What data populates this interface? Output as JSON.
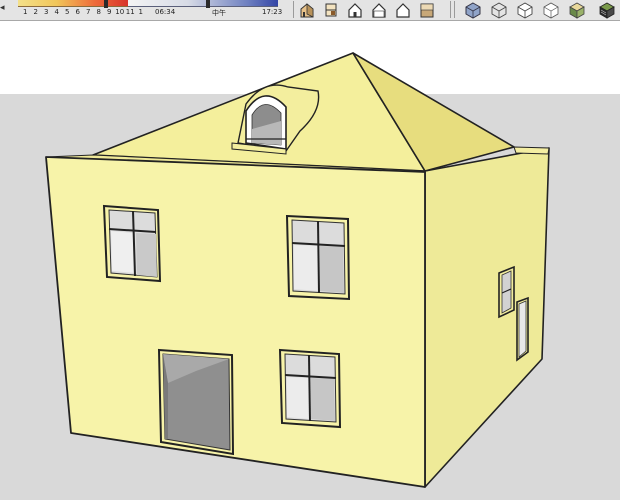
{
  "shadow_settings": {
    "month_labels": [
      "1",
      "2",
      "3",
      "4",
      "5",
      "6",
      "7",
      "8",
      "9",
      "10",
      "11",
      "1"
    ],
    "time_start": "06:34",
    "time_mid": "中午",
    "time_end": "17:23"
  },
  "toolbar": {
    "view_buttons": [
      {
        "name": "iso-view",
        "icon": "house-iso-icon"
      },
      {
        "name": "top-view",
        "icon": "house-top-icon"
      },
      {
        "name": "front-view",
        "icon": "house-front-icon"
      },
      {
        "name": "right-view",
        "icon": "house-right-icon"
      },
      {
        "name": "back-view",
        "icon": "house-back-icon"
      },
      {
        "name": "left-view",
        "icon": "house-left-icon"
      }
    ],
    "style_buttons": [
      {
        "name": "x-ray-style",
        "icon": "xray-cube-icon"
      },
      {
        "name": "wireframe-style",
        "icon": "wireframe-cube-icon"
      },
      {
        "name": "hidden-line-style",
        "icon": "hidden-line-cube-icon"
      },
      {
        "name": "shaded-style",
        "icon": "shaded-cube-icon"
      },
      {
        "name": "shaded-textures-style",
        "icon": "textured-cube-icon"
      },
      {
        "name": "monochrome-style",
        "icon": "monochrome-cube-icon"
      }
    ]
  },
  "colors": {
    "wall": "#f6f2a6",
    "wall_shade": "#eeea98",
    "roof": "#efe68a",
    "roof_shade": "#e6dc7c",
    "glass": "#d7d7d7",
    "opening": "#8f8f8f",
    "ground": "#d9d9d9",
    "sky": "#ffffff"
  }
}
